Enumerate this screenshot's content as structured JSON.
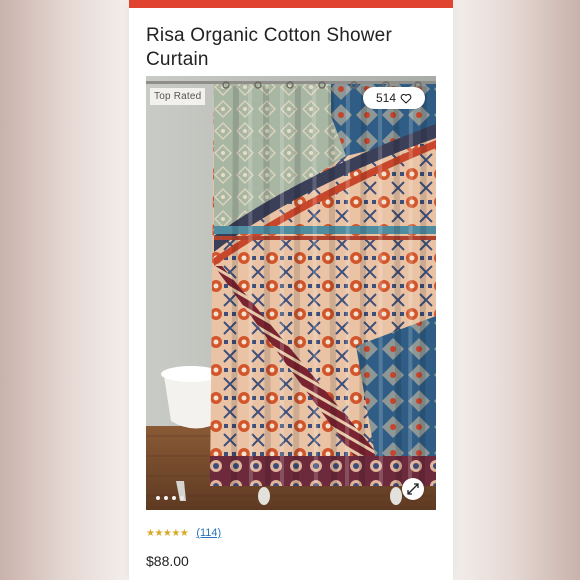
{
  "product": {
    "title": "Risa Organic Cotton Shower Curtain",
    "badge": "Top Rated",
    "favorites_count": "514",
    "rating_stars": "★★★★★",
    "review_count": "(114)",
    "price": "$88.00"
  },
  "gallery": {
    "dots": [
      true,
      false,
      false,
      false
    ]
  },
  "colors": {
    "accent": "#e0432f",
    "link": "#2a73b8",
    "star": "#d9a929"
  }
}
